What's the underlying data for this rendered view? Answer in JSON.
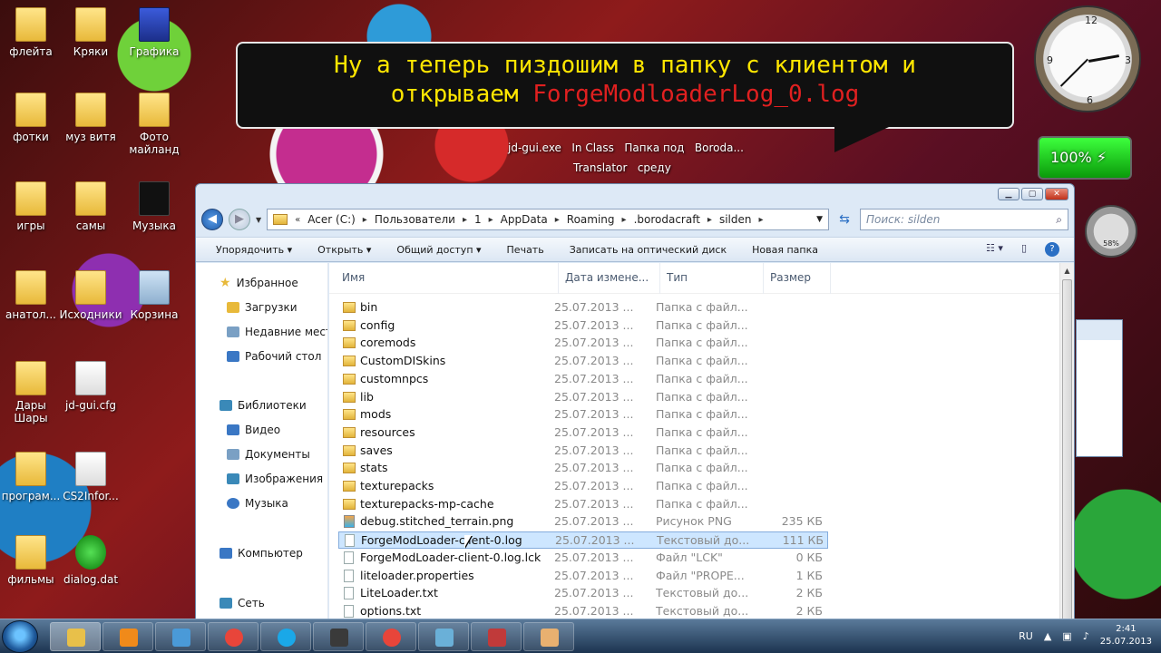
{
  "desktop_icons": [
    {
      "label": "флейта",
      "kind": "folder"
    },
    {
      "label": "Кряки",
      "kind": "folder"
    },
    {
      "label": "Графика",
      "kind": "blue"
    },
    {
      "label": "фотки",
      "kind": "folder"
    },
    {
      "label": "муз витя",
      "kind": "folder"
    },
    {
      "label": "Фото\nмайланд",
      "kind": "folder"
    },
    {
      "label": "игры",
      "kind": "folder"
    },
    {
      "label": "самы",
      "kind": "folder"
    },
    {
      "label": "Музыка",
      "kind": "black"
    },
    {
      "label": "анатол...",
      "kind": "folder"
    },
    {
      "label": "Исходники",
      "kind": "folder"
    },
    {
      "label": "Корзина",
      "kind": "bin"
    },
    {
      "label": "Дары\nШары",
      "kind": "folder"
    },
    {
      "label": "jd-gui.cfg",
      "kind": "doc"
    },
    {
      "label": "програм...",
      "kind": "folder"
    },
    {
      "label": "CS2Infor...",
      "kind": "doc"
    },
    {
      "label": "фильмы",
      "kind": "folder"
    },
    {
      "label": "dialog.dat",
      "kind": "green"
    }
  ],
  "banner": {
    "line1": "Ну а теперь пиздошим в папку с клиентом и",
    "line2_prefix": "открываем ",
    "line2_highlight": "ForgeModloaderLog_0.log"
  },
  "mini_labels": {
    "row1": "jd-gui.exe   In Class   Папка под   Boroda...",
    "row2": "Translator   среду"
  },
  "battery": {
    "percent_text": "100%"
  },
  "meter": {
    "value_text": "58%"
  },
  "explorer": {
    "window_buttons": {
      "minimize": "▁",
      "maximize": "▢",
      "close": "✕"
    },
    "path": [
      "Acer (C:)",
      "Пользователи",
      "1",
      "AppData",
      "Roaming",
      ".borodacraft",
      "silden"
    ],
    "search_placeholder": "Поиск: silden",
    "toolbar": {
      "organize": "Упорядочить ▾",
      "open": "Открыть ▾",
      "share": "Общий доступ ▾",
      "print": "Печать",
      "burn": "Записать на оптический диск",
      "new_folder": "Новая папка"
    },
    "nav_pane": {
      "favorites": "Избранное",
      "downloads": "Загрузки",
      "recent": "Недавние места",
      "desktop": "Рабочий стол",
      "libraries": "Библиотеки",
      "video": "Видео",
      "documents": "Документы",
      "images": "Изображения",
      "music": "Музыка",
      "computer": "Компьютер",
      "network": "Сеть"
    },
    "columns": {
      "name": "Имя",
      "date": "Дата измене...",
      "type": "Тип",
      "size": "Размер"
    },
    "files": [
      {
        "name": "bin",
        "date": "25.07.2013 ...",
        "type": "Папка с файл...",
        "size": "",
        "kind": "folder"
      },
      {
        "name": "config",
        "date": "25.07.2013 ...",
        "type": "Папка с файл...",
        "size": "",
        "kind": "folder"
      },
      {
        "name": "coremods",
        "date": "25.07.2013 ...",
        "type": "Папка с файл...",
        "size": "",
        "kind": "folder"
      },
      {
        "name": "CustomDISkins",
        "date": "25.07.2013 ...",
        "type": "Папка с файл...",
        "size": "",
        "kind": "folder"
      },
      {
        "name": "customnpcs",
        "date": "25.07.2013 ...",
        "type": "Папка с файл...",
        "size": "",
        "kind": "folder"
      },
      {
        "name": "lib",
        "date": "25.07.2013 ...",
        "type": "Папка с файл...",
        "size": "",
        "kind": "folder"
      },
      {
        "name": "mods",
        "date": "25.07.2013 ...",
        "type": "Папка с файл...",
        "size": "",
        "kind": "folder"
      },
      {
        "name": "resources",
        "date": "25.07.2013 ...",
        "type": "Папка с файл...",
        "size": "",
        "kind": "folder"
      },
      {
        "name": "saves",
        "date": "25.07.2013 ...",
        "type": "Папка с файл...",
        "size": "",
        "kind": "folder"
      },
      {
        "name": "stats",
        "date": "25.07.2013 ...",
        "type": "Папка с файл...",
        "size": "",
        "kind": "folder"
      },
      {
        "name": "texturepacks",
        "date": "25.07.2013 ...",
        "type": "Папка с файл...",
        "size": "",
        "kind": "folder"
      },
      {
        "name": "texturepacks-mp-cache",
        "date": "25.07.2013 ...",
        "type": "Папка с файл...",
        "size": "",
        "kind": "folder"
      },
      {
        "name": "debug.stitched_terrain.png",
        "date": "25.07.2013 ...",
        "type": "Рисунок PNG",
        "size": "235 КБ",
        "kind": "png"
      },
      {
        "name": "ForgeModLoader-client-0.log",
        "date": "25.07.2013 ...",
        "type": "Текстовый до...",
        "size": "111 КБ",
        "kind": "file",
        "selected": true
      },
      {
        "name": "ForgeModLoader-client-0.log.lck",
        "date": "25.07.2013 ...",
        "type": "Файл \"LCK\"",
        "size": "0 КБ",
        "kind": "file"
      },
      {
        "name": "liteloader.properties",
        "date": "25.07.2013 ...",
        "type": "Файл \"PROPE...",
        "size": "1 КБ",
        "kind": "file"
      },
      {
        "name": "LiteLoader.txt",
        "date": "25.07.2013 ...",
        "type": "Текстовый до...",
        "size": "2 КБ",
        "kind": "file"
      },
      {
        "name": "options.txt",
        "date": "25.07.2013 ...",
        "type": "Текстовый до...",
        "size": "2 КБ",
        "kind": "file"
      }
    ]
  },
  "taskbar": {
    "language": "RU",
    "time": "2:41",
    "date": "25.07.2013",
    "apps": [
      "explorer",
      "media-player",
      "paint",
      "chrome",
      "skype",
      "minecraft",
      "chrome",
      "notepad",
      "game",
      "archive"
    ]
  },
  "colors": {
    "selection": "#cde6ff",
    "banner_text": "#ffe600",
    "banner_highlight": "#e02020"
  }
}
